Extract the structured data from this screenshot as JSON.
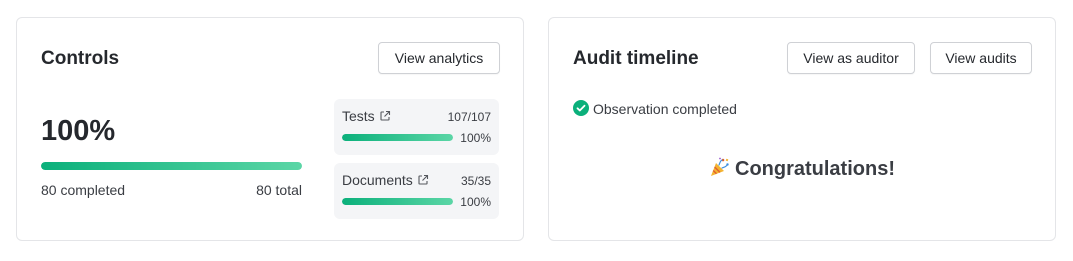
{
  "controls": {
    "title": "Controls",
    "view_analytics_label": "View analytics",
    "percent_text": "100%",
    "progress_fraction": 1.0,
    "completed_text": "80 completed",
    "total_text": "80 total",
    "tests": {
      "label": "Tests",
      "count": "107/107",
      "percent": "100%",
      "progress_fraction": 1.0,
      "icon": "external-link-icon"
    },
    "documents": {
      "label": "Documents",
      "count": "35/35",
      "percent": "100%",
      "progress_fraction": 1.0,
      "icon": "external-link-icon"
    },
    "accent_color": "#0bb07b"
  },
  "audit": {
    "title": "Audit timeline",
    "view_as_auditor_label": "View as auditor",
    "view_audits_label": "View audits",
    "status_text": "Observation completed",
    "status_icon": "check-circle-icon",
    "congrats_text": "Congratulations!",
    "congrats_icon": "party-popper-icon"
  }
}
